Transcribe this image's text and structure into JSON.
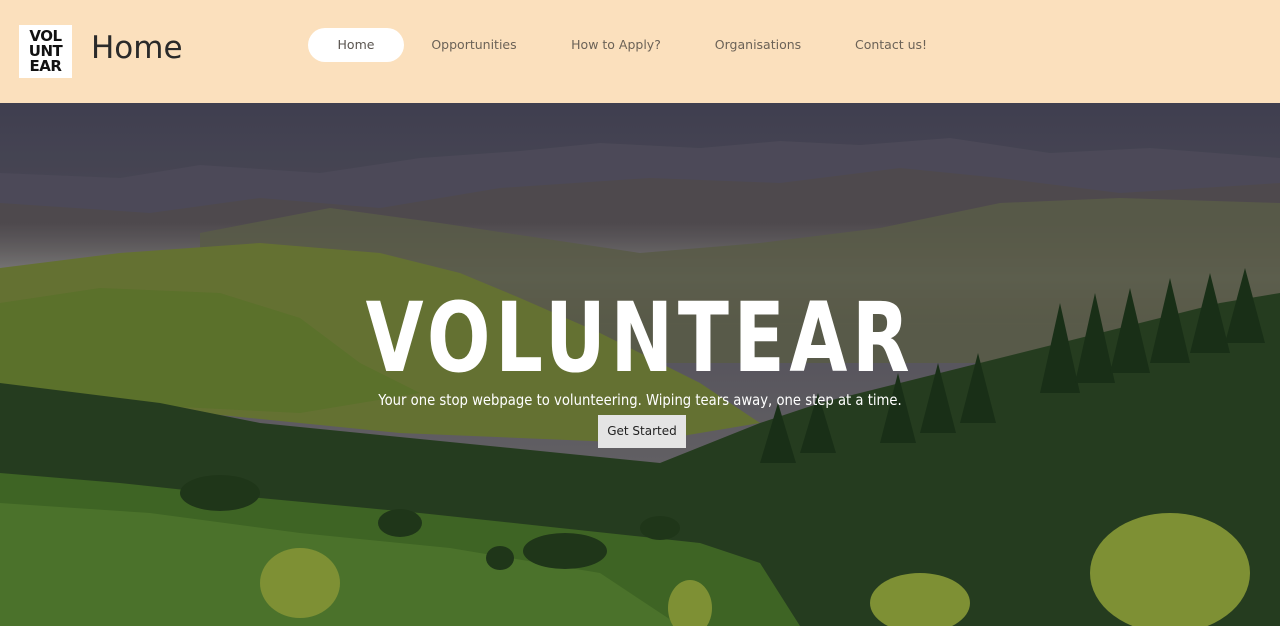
{
  "logo": {
    "lines": [
      "VOL",
      "UNT",
      "EAR"
    ]
  },
  "site_title": "Home",
  "nav": {
    "items": [
      {
        "label": "Home",
        "active": true
      },
      {
        "label": "Opportunities",
        "active": false
      },
      {
        "label": "How to Apply?",
        "active": false
      },
      {
        "label": "Organisations",
        "active": false
      },
      {
        "label": "Contact us!",
        "active": false
      }
    ]
  },
  "hero": {
    "title": "VOLUNTEAR",
    "subtitle": "Your one stop webpage to volunteering. Wiping tears away, one step at a time.",
    "cta_label": "Get Started"
  },
  "colors": {
    "header_bg": "#fbe0bd",
    "nav_active_bg": "#ffffff",
    "cta_bg": "#e4e4e4"
  }
}
